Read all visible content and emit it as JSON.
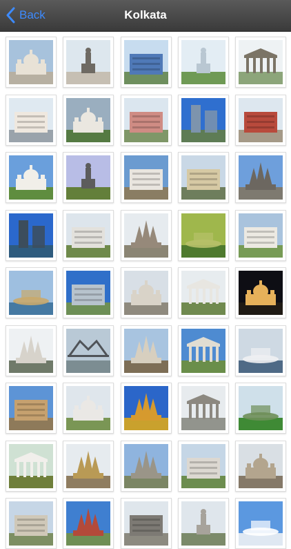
{
  "nav": {
    "back_label": "Back",
    "title": "Kolkata",
    "accent": "#3d8bff"
  },
  "photos": [
    {
      "sky": "#a7c2dc",
      "ground": "#b7b0a2",
      "bld": "#e8e2d6",
      "shape": "dome"
    },
    {
      "sky": "#dde7ee",
      "ground": "#c6bfb3",
      "bld": "#6e6a63",
      "shape": "statue"
    },
    {
      "sky": "#c7dcef",
      "ground": "#6e8f5e",
      "bld": "#4f79b7",
      "shape": "block"
    },
    {
      "sky": "#e3edf4",
      "ground": "#6f9a55",
      "bld": "#b9c7d2",
      "shape": "statue"
    },
    {
      "sky": "#eef2f4",
      "ground": "#8ca57a",
      "bld": "#7b7466",
      "shape": "columns"
    },
    {
      "sky": "#dfe9f1",
      "ground": "#9aa3ab",
      "bld": "#efe8df",
      "shape": "block"
    },
    {
      "sky": "#9aaebf",
      "ground": "#557a43",
      "bld": "#eae7e0",
      "shape": "dome"
    },
    {
      "sky": "#dbe6ef",
      "ground": "#7f9768",
      "bld": "#cf8c84",
      "shape": "block"
    },
    {
      "sky": "#2f6fcf",
      "ground": "#5e7c55",
      "bld": "#7d94ad",
      "shape": "tower"
    },
    {
      "sky": "#dde7ef",
      "ground": "#a59a88",
      "bld": "#b84a3c",
      "shape": "block"
    },
    {
      "sky": "#6a9fdc",
      "ground": "#5f8d3f",
      "bld": "#f1efe9",
      "shape": "dome"
    },
    {
      "sky": "#b8bde6",
      "ground": "#637f3a",
      "bld": "#5c5c5c",
      "shape": "statue"
    },
    {
      "sky": "#6b9bd0",
      "ground": "#8a7d63",
      "bld": "#e9e5df",
      "shape": "block"
    },
    {
      "sky": "#c9d8e6",
      "ground": "#6e7e5d",
      "bld": "#d6c9a4",
      "shape": "block"
    },
    {
      "sky": "#6e9fdc",
      "ground": "#7e7a70",
      "bld": "#6c6760",
      "shape": "temple"
    },
    {
      "sky": "#2b68cc",
      "ground": "#2e5b7e",
      "bld": "#3c4d5c",
      "shape": "tower"
    },
    {
      "sky": "#dde5ec",
      "ground": "#6f8a4b",
      "bld": "#e3e1dc",
      "shape": "block"
    },
    {
      "sky": "#e6ebef",
      "ground": "#8b8574",
      "bld": "#96897a",
      "shape": "temple"
    },
    {
      "sky": "#9fb74c",
      "ground": "#4e7a2e",
      "bld": "#b7c06a",
      "shape": "pond"
    },
    {
      "sky": "#a9c3dd",
      "ground": "#779b55",
      "bld": "#ece9e2",
      "shape": "block"
    },
    {
      "sky": "#9ebfe0",
      "ground": "#4579a2",
      "bld": "#c9a96b",
      "shape": "pond"
    },
    {
      "sky": "#2f6fc9",
      "ground": "#6d8f56",
      "bld": "#b7c3cd",
      "shape": "block"
    },
    {
      "sky": "#d8dfe6",
      "ground": "#8f8a7e",
      "bld": "#d9d3c8",
      "shape": "dome"
    },
    {
      "sky": "#e7ecef",
      "ground": "#708a4f",
      "bld": "#e8e6e1",
      "shape": "columns"
    },
    {
      "sky": "#0e0e14",
      "ground": "#1f1a14",
      "bld": "#e6b15a",
      "shape": "dome"
    },
    {
      "sky": "#eef1f3",
      "ground": "#6f7a69",
      "bld": "#d7d3cb",
      "shape": "temple"
    },
    {
      "sky": "#b9c9d6",
      "ground": "#7c8d92",
      "bld": "#4f5358",
      "shape": "bridge"
    },
    {
      "sky": "#a8c4e0",
      "ground": "#7d6e56",
      "bld": "#d7cfbf",
      "shape": "temple"
    },
    {
      "sky": "#4e8bd1",
      "ground": "#6a8e4a",
      "bld": "#e1ddd2",
      "shape": "columns"
    },
    {
      "sky": "#ced9e3",
      "ground": "#4f6a86",
      "bld": "#f0f0f2",
      "shape": "pond"
    },
    {
      "sky": "#5d94d6",
      "ground": "#8e7a5a",
      "bld": "#c6a16f",
      "shape": "block"
    },
    {
      "sky": "#dfe6ec",
      "ground": "#7a9655",
      "bld": "#eae8e5",
      "shape": "dome"
    },
    {
      "sky": "#2b66c9",
      "ground": "#c9a12d",
      "bld": "#d69a2e",
      "shape": "temple"
    },
    {
      "sky": "#e7ebee",
      "ground": "#92948d",
      "bld": "#8c8880",
      "shape": "columns"
    },
    {
      "sky": "#cfe0ea",
      "ground": "#3f8a35",
      "bld": "#6e8f59",
      "shape": "pond"
    },
    {
      "sky": "#cfe1d3",
      "ground": "#6f7f3a",
      "bld": "#f1efeb",
      "shape": "columns"
    },
    {
      "sky": "#e6ebef",
      "ground": "#8f7d60",
      "bld": "#b99a55",
      "shape": "temple"
    },
    {
      "sky": "#8fb4de",
      "ground": "#7b8664",
      "bld": "#9a9588",
      "shape": "temple"
    },
    {
      "sky": "#c5d6e6",
      "ground": "#6c8d4f",
      "bld": "#dcd8d1",
      "shape": "block"
    },
    {
      "sky": "#d9dfe4",
      "ground": "#857968",
      "bld": "#b3a58e",
      "shape": "dome"
    },
    {
      "sky": "#c6d6e6",
      "ground": "#7d8f63",
      "bld": "#cfc8b8",
      "shape": "block"
    },
    {
      "sky": "#3f7fd0",
      "ground": "#6e8f55",
      "bld": "#b34a3a",
      "shape": "temple"
    },
    {
      "sky": "#dfe6ec",
      "ground": "#8c8a80",
      "bld": "#7d7a74",
      "shape": "block"
    },
    {
      "sky": "#dfe6ec",
      "ground": "#7b8a6a",
      "bld": "#a7a39b",
      "shape": "statue"
    },
    {
      "sky": "#5b98e0",
      "ground": "#dfe8f2",
      "bld": "#ffffff",
      "shape": "pond"
    }
  ]
}
